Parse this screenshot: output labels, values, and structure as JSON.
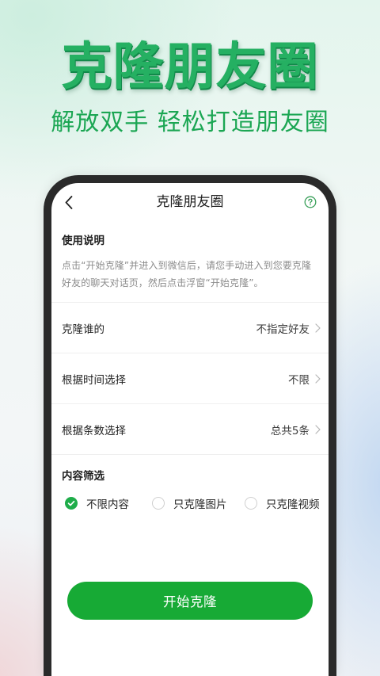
{
  "promo": {
    "title": "克隆朋友圈",
    "subtitle": "解放双手 轻松打造朋友圈"
  },
  "screen": {
    "header": {
      "back_icon": "chevron-left-icon",
      "title": "克隆朋友圈",
      "help_icon": "help-circle-icon"
    },
    "usage": {
      "heading": "使用说明",
      "lines": [
        "点击“开始克隆”并进入到微信后，请您手动进入到您要克隆",
        "好友的聊天对话页，然后点击浮窗“开始克隆”。"
      ]
    },
    "settings": [
      {
        "label": "克隆谁的",
        "value": "不指定好友"
      },
      {
        "label": "根据时间选择",
        "value": "不限"
      },
      {
        "label": "根据条数选择",
        "value": "总共5条"
      }
    ],
    "row_icon": "chevron-right-icon",
    "filter": {
      "heading": "内容筛选",
      "options": [
        {
          "label": "不限内容",
          "selected": true
        },
        {
          "label": "只克隆图片",
          "selected": false
        },
        {
          "label": "只克隆视频",
          "selected": false
        }
      ]
    },
    "start_button": "开始克隆"
  },
  "colors": {
    "title_green": "#25b062",
    "subtitle_green": "#1ba653",
    "button_green": "#17aa35",
    "check_green": "#1fad4a",
    "help_green": "#3aa05a",
    "frame_dark": "#2a2a2a"
  }
}
